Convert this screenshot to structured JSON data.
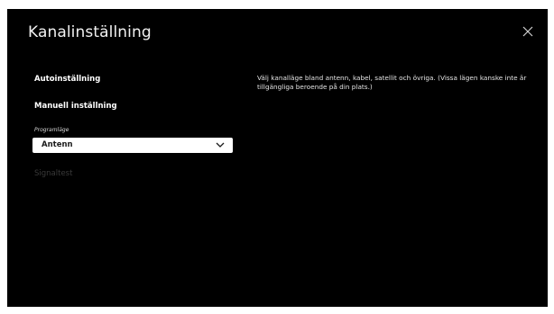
{
  "header": {
    "title": "Kanalinställning",
    "close_icon": "close-icon"
  },
  "menu": {
    "auto_setup": "Autoinställning",
    "manual_setup": "Manuell inställning",
    "program_mode_label": "Programläge",
    "program_mode_value": "Antenn",
    "chevron_icon": "chevron-down-icon",
    "signal_test": "Signaltest"
  },
  "info": {
    "description": "Välj kanalläge bland antenn, kabel, satellit och övriga. (Vissa lägen kanske inte är tillgängliga beroende på din plats.)"
  },
  "colors": {
    "background": "#000000",
    "text": "#ffffff",
    "disabled_text": "#3a3a3a",
    "dropdown_bg": "#ffffff",
    "dropdown_text": "#1a1a1a"
  }
}
